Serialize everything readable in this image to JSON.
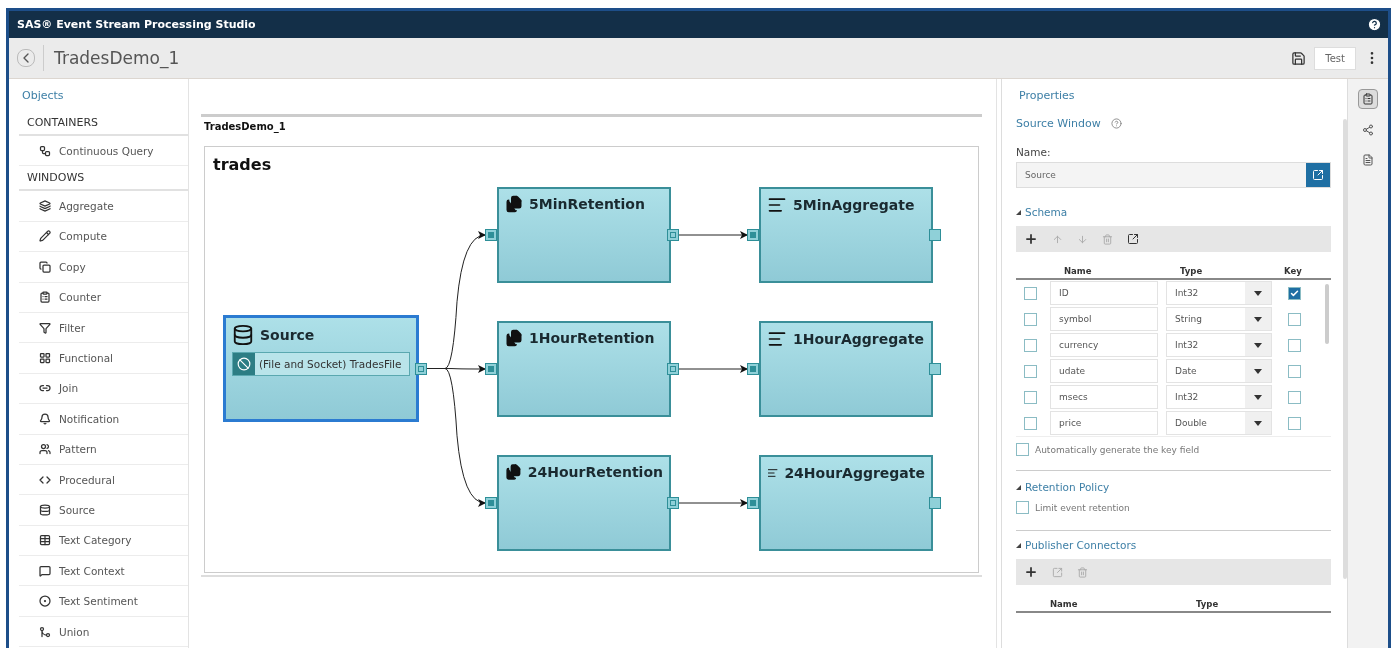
{
  "app": {
    "title": "SAS® Event Stream Processing Studio"
  },
  "toolbar": {
    "project": "TradesDemo_1",
    "test_button": "Test"
  },
  "objects": {
    "title": "Objects",
    "sections": [
      {
        "heading": "CONTAINERS",
        "items": [
          "Continuous Query"
        ]
      },
      {
        "heading": "WINDOWS",
        "items": [
          "Aggregate",
          "Compute",
          "Copy",
          "Counter",
          "Filter",
          "Functional",
          "Join",
          "Notification",
          "Pattern",
          "Procedural",
          "Source",
          "Text Category",
          "Text Context",
          "Text Sentiment",
          "Union"
        ]
      }
    ]
  },
  "canvas": {
    "project": "TradesDemo_1",
    "query": "trades",
    "windows": [
      {
        "name": "Source",
        "kind": "source",
        "selected": true,
        "connector": "(File and Socket) TradesFile"
      },
      {
        "name": "5MinRetention",
        "kind": "copy",
        "selected": false
      },
      {
        "name": "1HourRetention",
        "kind": "copy",
        "selected": false
      },
      {
        "name": "24HourRetention",
        "kind": "copy",
        "selected": false
      },
      {
        "name": "5MinAggregate",
        "kind": "aggregate",
        "selected": false
      },
      {
        "name": "1HourAggregate",
        "kind": "aggregate",
        "selected": false
      },
      {
        "name": "24HourAggregate",
        "kind": "aggregate",
        "selected": false
      }
    ]
  },
  "properties": {
    "title": "Properties",
    "heading": "Source Window",
    "name_label": "Name:",
    "name_value": "Source",
    "schema": {
      "title": "Schema",
      "expanded": true,
      "columns": [
        "Name",
        "Type",
        "Key"
      ],
      "fields": [
        {
          "name": "ID",
          "type": "Int32",
          "checked": false,
          "key": true
        },
        {
          "name": "symbol",
          "type": "String",
          "checked": false,
          "key": false
        },
        {
          "name": "currency",
          "type": "Int32",
          "checked": false,
          "key": false
        },
        {
          "name": "udate",
          "type": "Date",
          "checked": false,
          "key": false
        },
        {
          "name": "msecs",
          "type": "Int32",
          "checked": false,
          "key": false
        },
        {
          "name": "price",
          "type": "Double",
          "checked": false,
          "key": false
        }
      ],
      "auto_key": {
        "label": "Automatically generate the key field",
        "checked": false
      }
    },
    "retention": {
      "title": "Retention Policy",
      "expanded": true,
      "limit": {
        "label": "Limit event retention",
        "checked": false
      }
    },
    "publishers": {
      "title": "Publisher Connectors",
      "expanded": true,
      "columns": [
        "Name",
        "Type"
      ]
    }
  }
}
